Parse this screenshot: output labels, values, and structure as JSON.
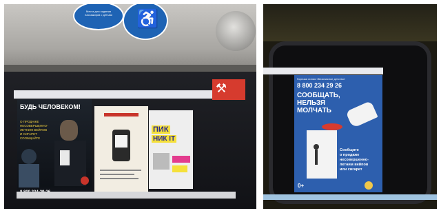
{
  "left_photo": {
    "sign_texts": [
      "Места для\nсидения пассажиров\nс детьми"
    ],
    "poster1": {
      "title": "БУДЬ ЧЕЛОВЕКОМ!",
      "lines": [
        "О ПРОДАЖЕ",
        "НЕСОВЕРШЕННО-",
        "ЛЕТНИМ ВЕЙПОВ",
        "И СИГАРЕТ",
        "СООБЩАЙТЕ"
      ],
      "phone": "8 800 234-29-26"
    },
    "poster3": {
      "title_line1": "ПИК",
      "title_line2": "НИК IT"
    }
  },
  "right_photo": {
    "poster": {
      "header": "Горячая линия «Безопасное детство»",
      "phone": "8 800 234 29 26",
      "headline_line1": "СООБЩАТЬ,",
      "headline_line2": "НЕЛЬЗЯ",
      "headline_line3": "МОЛЧАТЬ",
      "body": [
        "Сообщите",
        "о продаже",
        "несовершенно-",
        "летним вейпов",
        "или сигарет"
      ],
      "age": "0+"
    }
  },
  "colors": {
    "sign_blue": "#1e63b4",
    "poster_blue": "#2d5fae",
    "poster_red": "#d63b2e"
  }
}
